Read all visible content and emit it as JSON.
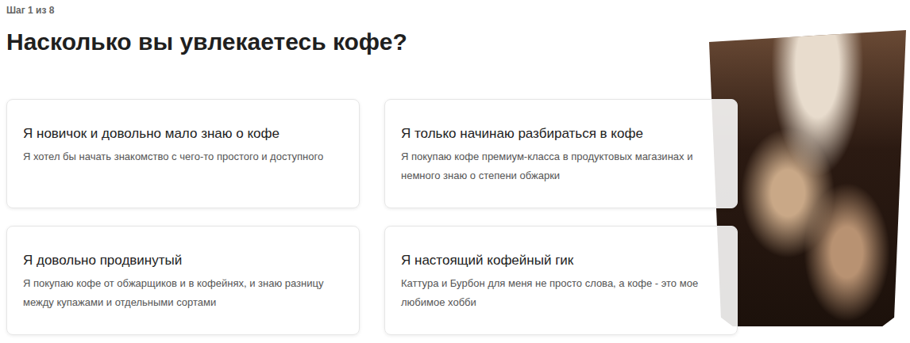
{
  "step": "Шаг 1 из 8",
  "title": "Насколько вы увлекаетесь кофе?",
  "options": [
    {
      "title": "Я новичок и довольно мало знаю о кофе",
      "description": "Я хотел бы начать знакомство с чего-то простого и доступного",
      "selected": false
    },
    {
      "title": "Я только начинаю разбираться в кофе",
      "description": "Я покупаю кофе премиум-класса в продуктовых магазинах и немного знаю о степени обжарки",
      "selected": false
    },
    {
      "title": "Я довольно продвинутый",
      "description": "Я покупаю кофе от обжарщиков и в кофейнях, и знаю разницу между купажами и отдельными сортами",
      "selected": false
    },
    {
      "title": "Я настоящий кофейный гик",
      "description": "Каттура и Бурбон для меня не просто слова, а кофе - это мое любимое хобби",
      "selected": false
    }
  ]
}
